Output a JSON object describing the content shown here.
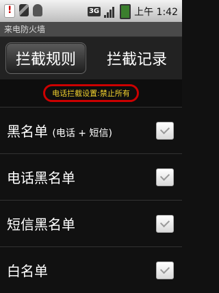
{
  "status_bar": {
    "network": "3G",
    "time": "上午 1:42"
  },
  "app": {
    "title": "来电防火墙"
  },
  "tabs": [
    {
      "label": "拦截规则",
      "active": true
    },
    {
      "label": "拦截记录",
      "active": false
    }
  ],
  "banner": {
    "text": "电话拦截设置:禁止所有"
  },
  "list": [
    {
      "label": "黑名单",
      "sub": "(电话 + 短信)",
      "checked": false
    },
    {
      "label": "电话黑名单",
      "sub": "",
      "checked": false
    },
    {
      "label": "短信黑名单",
      "sub": "",
      "checked": false
    },
    {
      "label": "白名单",
      "sub": "",
      "checked": false
    }
  ]
}
